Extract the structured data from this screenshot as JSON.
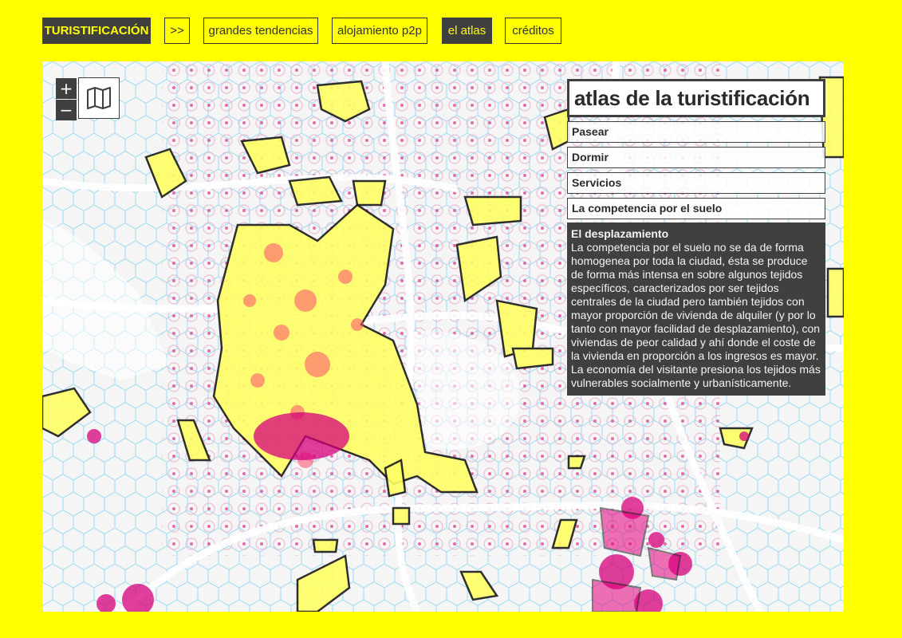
{
  "nav": {
    "brand": "TURISTIFICACIÓN",
    "arrow": ">>",
    "items": [
      {
        "label": "grandes tendencias"
      },
      {
        "label": "alojamiento p2p"
      },
      {
        "label": "el atlas"
      },
      {
        "label": "créditos"
      }
    ],
    "active": "el atlas"
  },
  "map": {
    "zoom_in": "+",
    "zoom_out": "−",
    "layers_icon": "map-icon",
    "colors": {
      "page_background": "#ffff00",
      "panel_dark": "#404040",
      "area_fill": "#ffff55",
      "hexagon": "#4fc3f7",
      "magenta": "#e6007e",
      "pink_ring": "#f48fb1"
    }
  },
  "panel": {
    "title": "atlas de la turistificación",
    "items": [
      {
        "label": "Pasear"
      },
      {
        "label": "Dormir"
      },
      {
        "label": "Servicios"
      },
      {
        "label": "La competencia por el suelo"
      }
    ],
    "active_box": {
      "title": "El desplazamiento",
      "text": "La competencia por el suelo no se da de forma homogenea por toda la ciudad, ésta se produce de forma más intensa en sobre algunos tejidos específicos, caracterizados por ser tejidos centrales de la ciudad pero también tejidos con mayor proporción de vivienda de alquiler (y por lo tanto con mayor facilidad de desplazamiento), con viviendas de peor calidad y ahí donde el coste de la vivienda en proporción a los ingresos es mayor. La economía del visitante presiona los tejidos más vulnerables socialmente y urbanísticamente."
    }
  }
}
